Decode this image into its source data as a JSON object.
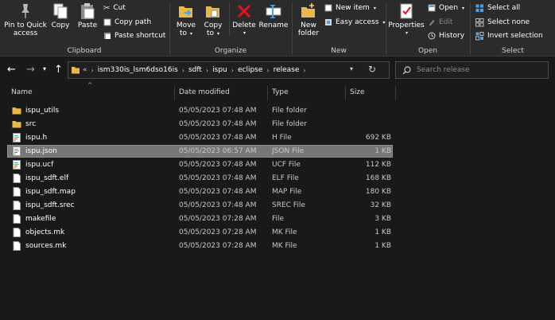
{
  "ribbon": {
    "clipboard": {
      "label": "Clipboard",
      "pin_label_1": "Pin to Quick",
      "pin_label_2": "access",
      "copy_label": "Copy",
      "paste_label": "Paste",
      "cut_label": "Cut",
      "copy_path_label": "Copy path",
      "paste_shortcut_label": "Paste shortcut"
    },
    "organize": {
      "label": "Organize",
      "move_to_1": "Move",
      "move_to_2": "to",
      "copy_to_1": "Copy",
      "copy_to_2": "to",
      "delete_label": "Delete",
      "rename_label": "Rename"
    },
    "new": {
      "label": "New",
      "new_folder_1": "New",
      "new_folder_2": "folder",
      "new_item_label": "New item",
      "easy_access_label": "Easy access"
    },
    "open": {
      "label": "Open",
      "properties_label": "Properties",
      "open_label": "Open",
      "edit_label": "Edit",
      "history_label": "History"
    },
    "select": {
      "label": "Select",
      "select_all_label": "Select all",
      "select_none_label": "Select none",
      "invert_label": "Invert selection"
    }
  },
  "address": {
    "overflow": "«",
    "crumbs": [
      "ism330is_lsm6dso16is",
      "sdft",
      "ispu",
      "eclipse",
      "release"
    ],
    "search_placeholder": "Search release"
  },
  "columns": {
    "name": "Name",
    "date": "Date modified",
    "type": "Type",
    "size": "Size"
  },
  "files": [
    {
      "name": "ispu_utils",
      "date": "05/05/2023 07:48 AM",
      "type": "File folder",
      "size": "",
      "icon": "folder"
    },
    {
      "name": "src",
      "date": "05/05/2023 07:48 AM",
      "type": "File folder",
      "size": "",
      "icon": "folder"
    },
    {
      "name": "ispu.h",
      "date": "05/05/2023 07:48 AM",
      "type": "H File",
      "size": "692 KB",
      "icon": "source"
    },
    {
      "name": "ispu.json",
      "date": "05/05/2023 06:57 AM",
      "type": "JSON File",
      "size": "1 KB",
      "icon": "source",
      "selected": true
    },
    {
      "name": "ispu.ucf",
      "date": "05/05/2023 07:48 AM",
      "type": "UCF File",
      "size": "112 KB",
      "icon": "source"
    },
    {
      "name": "ispu_sdft.elf",
      "date": "05/05/2023 07:48 AM",
      "type": "ELF File",
      "size": "168 KB",
      "icon": "file"
    },
    {
      "name": "ispu_sdft.map",
      "date": "05/05/2023 07:48 AM",
      "type": "MAP File",
      "size": "180 KB",
      "icon": "file"
    },
    {
      "name": "ispu_sdft.srec",
      "date": "05/05/2023 07:48 AM",
      "type": "SREC File",
      "size": "32 KB",
      "icon": "file"
    },
    {
      "name": "makefile",
      "date": "05/05/2023 07:28 AM",
      "type": "File",
      "size": "3 KB",
      "icon": "file"
    },
    {
      "name": "objects.mk",
      "date": "05/05/2023 07:28 AM",
      "type": "MK File",
      "size": "1 KB",
      "icon": "file"
    },
    {
      "name": "sources.mk",
      "date": "05/05/2023 07:28 AM",
      "type": "MK File",
      "size": "1 KB",
      "icon": "file"
    }
  ],
  "colors": {
    "background": "#191919",
    "ribbon": "#2b2b2b",
    "selection": "#777777",
    "folder": "#e8b949",
    "delete_red": "#e81123",
    "accent_blue": "#4aa3e8"
  }
}
